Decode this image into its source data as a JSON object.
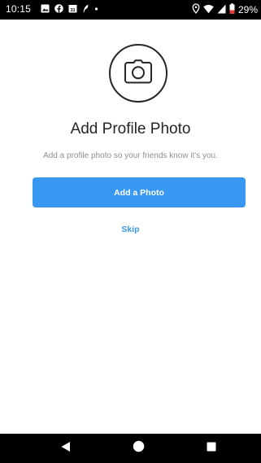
{
  "status_bar": {
    "time": "10:15",
    "battery_percent": "29%",
    "left_icons": [
      "image-icon",
      "facebook-icon",
      "calendar-icon",
      "feather-icon",
      "dot-icon"
    ],
    "right_icons": [
      "location-icon",
      "wifi-icon",
      "signal-icon",
      "battery-icon"
    ],
    "battery_color": "#e53935"
  },
  "content": {
    "icon": "camera-icon",
    "title": "Add Profile Photo",
    "subtitle": "Add a profile photo so your friends know it's you.",
    "primary_button_label": "Add a Photo",
    "skip_label": "Skip"
  },
  "nav_bar": {
    "items": [
      "back-icon",
      "home-icon",
      "recents-icon"
    ]
  },
  "colors": {
    "accent": "#3897f0",
    "text_primary": "#262626",
    "text_secondary": "#8e8e8e"
  }
}
